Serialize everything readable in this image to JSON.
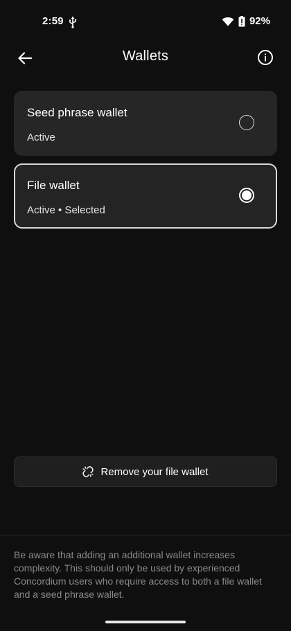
{
  "status_bar": {
    "time": "2:59",
    "battery": "92%",
    "icons": [
      "usb-icon",
      "wifi-icon",
      "battery-icon"
    ]
  },
  "header": {
    "title": "Wallets",
    "back_icon": "arrow-left-icon",
    "info_icon": "info-icon"
  },
  "wallets": [
    {
      "name": "Seed phrase wallet",
      "status": "Active",
      "selected": false
    },
    {
      "name": "File wallet",
      "status": "Active • Selected",
      "selected": true
    }
  ],
  "remove_button": {
    "label": "Remove your file wallet",
    "icon": "unlink-icon"
  },
  "note": "Be aware that adding an additional wallet increases complexity. This should only be used by experienced Concordium users who require access to both a file wallet and a seed phrase wallet.",
  "colors": {
    "background": "#0f0f0f",
    "card": "#262626",
    "selected_border": "#d9d9d9",
    "muted_text": "#8a8a8a"
  }
}
